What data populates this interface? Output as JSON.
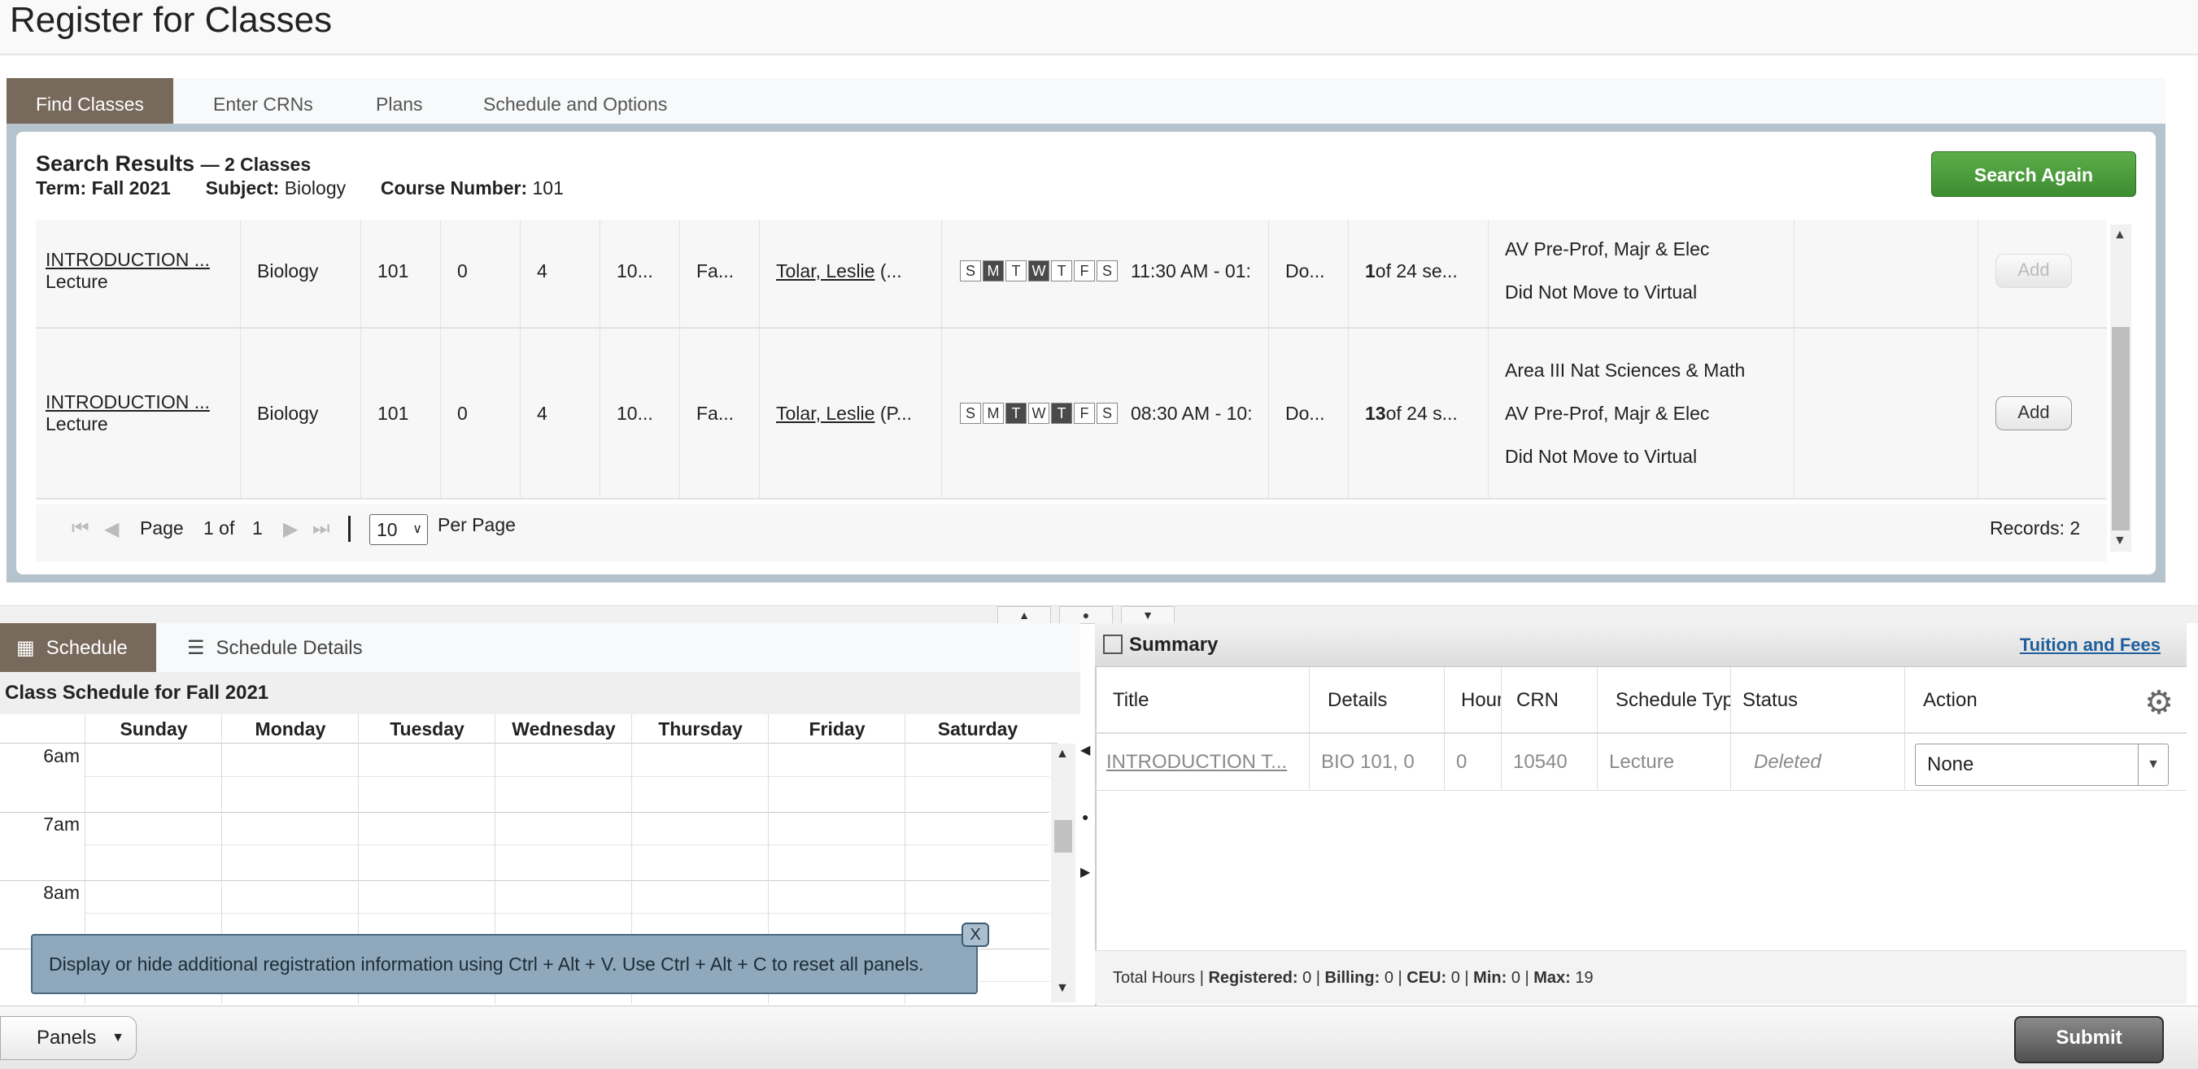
{
  "page_title": "Register for Classes",
  "tabs": [
    {
      "label": "Find Classes"
    },
    {
      "label": "Enter CRNs"
    },
    {
      "label": "Plans"
    },
    {
      "label": "Schedule and Options"
    }
  ],
  "results": {
    "heading": "Search Results",
    "count": "— 2 Classes",
    "term_label": "Term:",
    "term_value": "Fall 2021",
    "subject_label": "Subject:",
    "subject_value": "Biology",
    "course_label": "Course Number:",
    "course_value": "101",
    "search_again": "Search Again",
    "rows": [
      {
        "title": "INTRODUCTION ...",
        "type": "Lecture",
        "subject": "Biology",
        "course": "101",
        "section": "0",
        "hours": "4",
        "crn": "10...",
        "term": "Fa...",
        "instructor": "Tolar, Leslie",
        "instructor_extra": "(...",
        "days": [
          "S",
          "M",
          "T",
          "W",
          "T",
          "F",
          "S"
        ],
        "time": "11:30 AM - 01:",
        "campus": "Do...",
        "seats_num": "1",
        "seats_rest": " of 24 se...",
        "attributes": [
          "AV Pre-Prof, Majr & Elec",
          "Did Not Move to Virtual"
        ],
        "add": "Add"
      },
      {
        "title": "INTRODUCTION ...",
        "type": "Lecture",
        "subject": "Biology",
        "course": "101",
        "section": "0",
        "hours": "4",
        "crn": "10...",
        "term": "Fa...",
        "instructor": "Tolar, Leslie",
        "instructor_extra": "(P...",
        "days": [
          "S",
          "M",
          "T",
          "W",
          "T",
          "F",
          "S"
        ],
        "time": "08:30 AM - 10:",
        "campus": "Do...",
        "seats_num": "13",
        "seats_rest": " of 24 s...",
        "attributes": [
          "Area III Nat Sciences & Math",
          "AV Pre-Prof, Majr & Elec",
          "Did Not Move to Virtual"
        ],
        "add": "Add"
      }
    ],
    "pager": {
      "page_label": "Page",
      "page_value": "1 of",
      "page_total": "1",
      "per_page_value": "10",
      "per_page_label": "Per Page",
      "records": "Records: 2"
    }
  },
  "schedule": {
    "tab_schedule": "Schedule",
    "tab_details": "Schedule Details",
    "heading": "Class Schedule for Fall 2021",
    "days": [
      "Sunday",
      "Monday",
      "Tuesday",
      "Wednesday",
      "Thursday",
      "Friday",
      "Saturday"
    ],
    "hours": [
      "6am",
      "7am",
      "8am",
      ""
    ],
    "tooltip": "Display or hide additional registration information using Ctrl + Alt + V. Use Ctrl + Alt + C to reset all panels.",
    "tooltip_close": "X"
  },
  "summary": {
    "title": "Summary",
    "tuition_link": "Tuition and Fees",
    "columns": [
      "Title",
      "Details",
      "Hours",
      "CRN",
      "Schedule Type",
      "Status",
      "Action"
    ],
    "row": {
      "title": "INTRODUCTION T...",
      "details": "BIO 101, 0",
      "hours": "0",
      "crn": "10540",
      "schedule_type": "Lecture",
      "status": "Deleted",
      "action": "None"
    },
    "totals": {
      "prefix": "Total Hours |",
      "registered_label": "Registered:",
      "registered": "0",
      "billing_label": "Billing:",
      "billing": "0",
      "ceu_label": "CEU:",
      "ceu": "0",
      "min_label": "Min:",
      "min": "0",
      "max_label": "Max:",
      "max": "19"
    }
  },
  "footer": {
    "panels": "Panels",
    "submit": "Submit"
  }
}
